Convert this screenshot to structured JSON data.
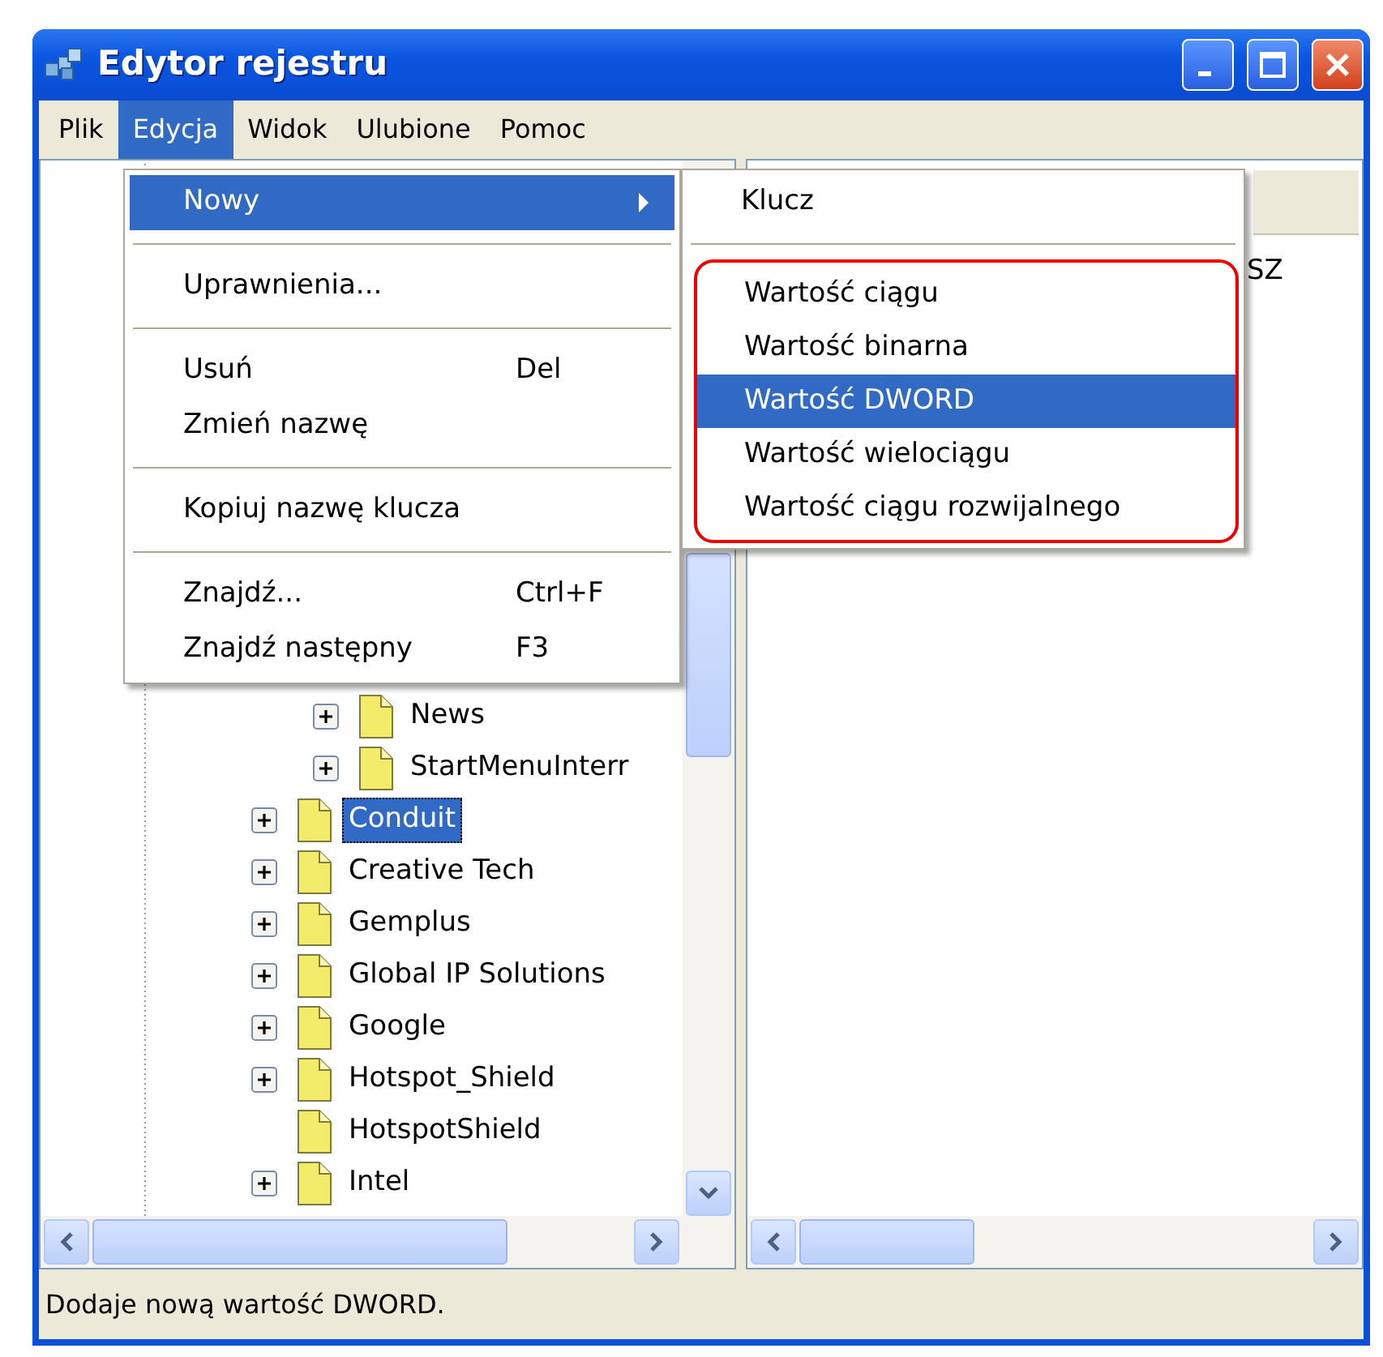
{
  "window": {
    "title": "Edytor rejestru"
  },
  "menubar": [
    {
      "label": "Plik",
      "selected": false
    },
    {
      "label": "Edycja",
      "selected": true
    },
    {
      "label": "Widok",
      "selected": false
    },
    {
      "label": "Ulubione",
      "selected": false
    },
    {
      "label": "Pomoc",
      "selected": false
    }
  ],
  "edit_menu": [
    {
      "kind": "item",
      "label": "Nowy",
      "submenu": true,
      "selected": true
    },
    {
      "kind": "separator"
    },
    {
      "kind": "item",
      "label": "Uprawnienia...",
      "selected": false
    },
    {
      "kind": "separator"
    },
    {
      "kind": "item",
      "label": "Usuń",
      "shortcut": "Del",
      "selected": false
    },
    {
      "kind": "item",
      "label": "Zmień nazwę",
      "selected": false
    },
    {
      "kind": "separator"
    },
    {
      "kind": "item",
      "label": "Kopiuj nazwę klucza",
      "selected": false
    },
    {
      "kind": "separator"
    },
    {
      "kind": "item",
      "label": "Znajdź...",
      "shortcut": "Ctrl+F",
      "selected": false
    },
    {
      "kind": "item",
      "label": "Znajdź następny",
      "shortcut": "F3",
      "selected": false
    }
  ],
  "new_submenu": {
    "items": [
      {
        "kind": "item",
        "label": "Klucz",
        "selected": false
      },
      {
        "kind": "separator"
      }
    ],
    "highlighted_group": [
      {
        "label": "Wartość ciągu",
        "selected": false
      },
      {
        "label": "Wartość binarna",
        "selected": false
      },
      {
        "label": "Wartość DWORD",
        "selected": true
      },
      {
        "label": "Wartość wielociągu",
        "selected": false
      },
      {
        "label": "Wartość ciągu rozwijalnego",
        "selected": false
      }
    ]
  },
  "tree": {
    "items": [
      {
        "children": [
          {
            "label": "News",
            "expandable": true,
            "selected": false
          },
          {
            "label": "StartMenuInterr",
            "expandable": true,
            "selected": false
          }
        ]
      },
      {
        "label": "Conduit",
        "expandable": true,
        "selected": true
      },
      {
        "label": "Creative Tech",
        "expandable": true,
        "selected": false
      },
      {
        "label": "Gemplus",
        "expandable": true,
        "selected": false
      },
      {
        "label": "Global IP Solutions",
        "expandable": true,
        "selected": false
      },
      {
        "label": "Google",
        "expandable": true,
        "selected": false
      },
      {
        "label": "Hotspot_Shield",
        "expandable": true,
        "selected": false
      },
      {
        "label": "HotspotShield",
        "expandable": false,
        "selected": false
      },
      {
        "label": "Intel",
        "expandable": true,
        "selected": false
      }
    ]
  },
  "values_pane": {
    "rows": [
      {
        "column_2": "SZ"
      }
    ]
  },
  "status_bar": "Dodaje nową wartość DWORD."
}
